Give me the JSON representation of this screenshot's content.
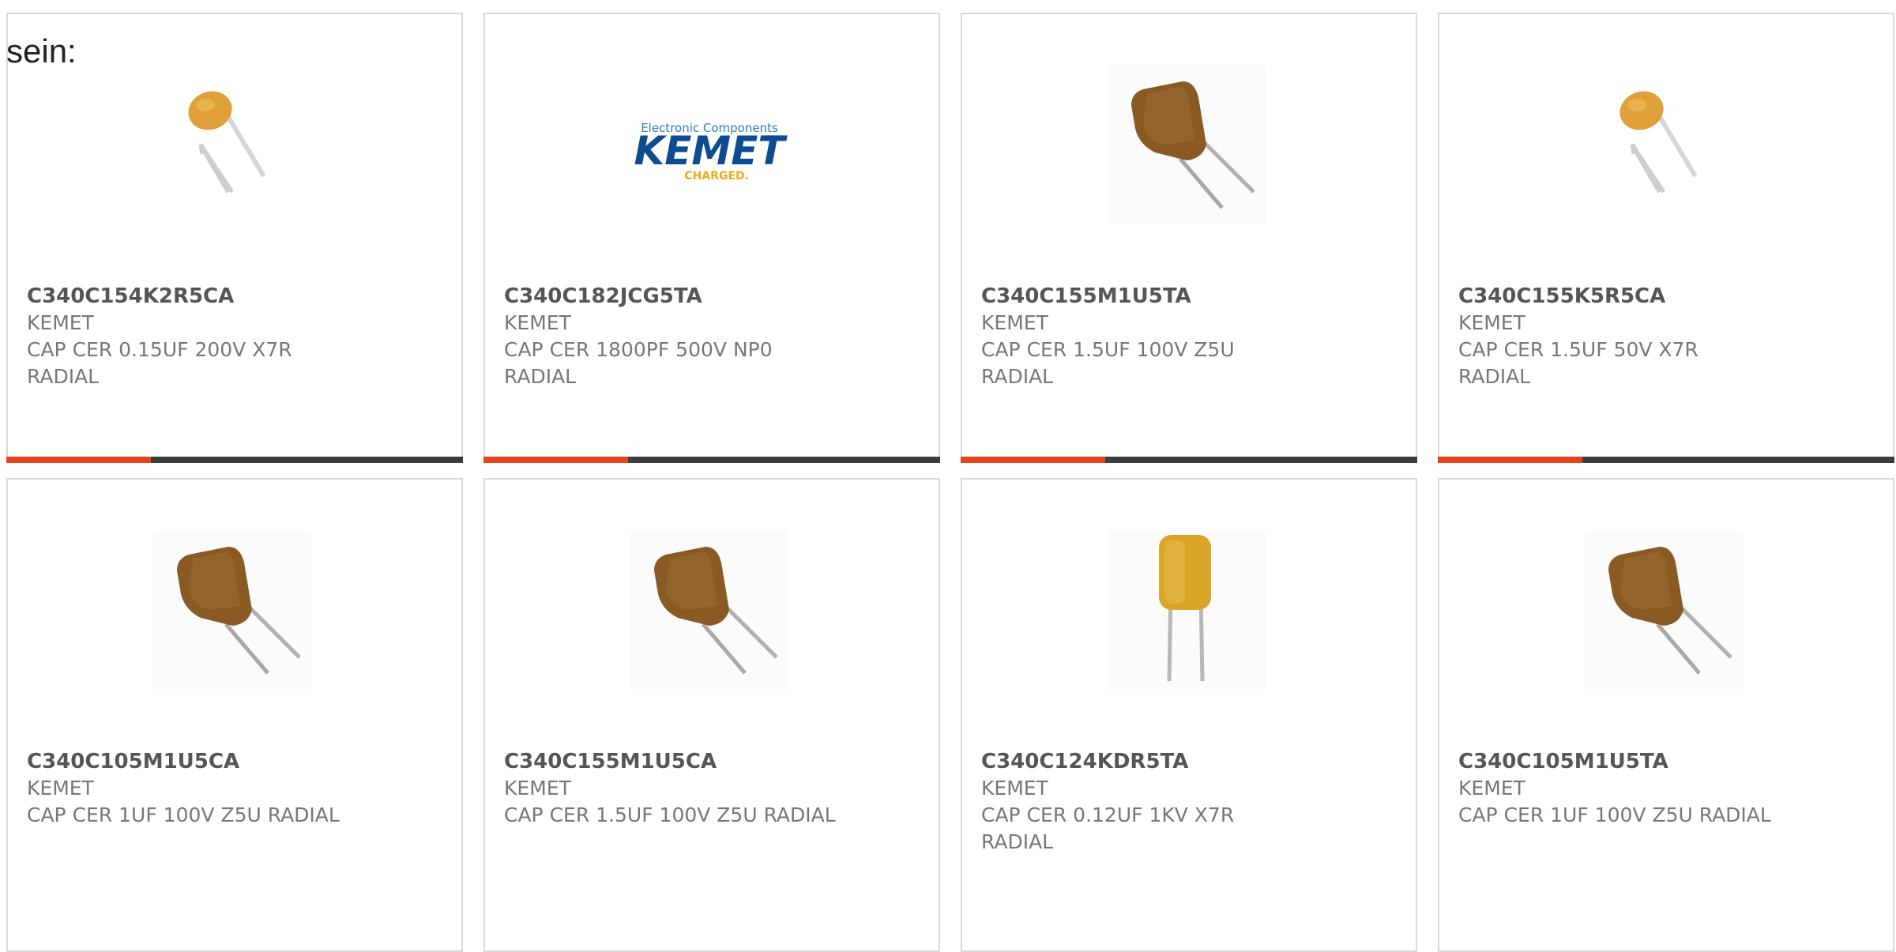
{
  "intro_text": "sein:",
  "products": [
    {
      "part": "C340C154K2R5CA",
      "mfr": "KEMET",
      "desc": "CAP CER 0.15UF 200V X7R RADIAL",
      "image": "small-orange-radial-capacitor-icon"
    },
    {
      "part": "C340C182JCG5TA",
      "mfr": "KEMET",
      "desc": "CAP CER 1800PF 500V NP0 RADIAL",
      "image": "kemet-logo",
      "logo": {
        "top": "Electronic Components",
        "main": "KEMET",
        "sub": "CHARGED."
      }
    },
    {
      "part": "C340C155M1U5TA",
      "mfr": "KEMET",
      "desc": "CAP CER 1.5UF 100V Z5U RADIAL",
      "image": "brown-radial-capacitor-icon"
    },
    {
      "part": "C340C155K5R5CA",
      "mfr": "KEMET",
      "desc": "CAP CER 1.5UF 50V X7R RADIAL",
      "image": "small-orange-radial-capacitor-icon"
    },
    {
      "part": "C340C105M1U5CA",
      "mfr": "KEMET",
      "desc": "CAP CER 1UF 100V Z5U RADIAL",
      "image": "brown-radial-capacitor-icon"
    },
    {
      "part": "C340C155M1U5CA",
      "mfr": "KEMET",
      "desc": "CAP CER 1.5UF 100V Z5U RADIAL",
      "image": "brown-radial-capacitor-icon"
    },
    {
      "part": "C340C124KDR5TA",
      "mfr": "KEMET",
      "desc": "CAP CER 0.12UF 1KV X7R RADIAL",
      "image": "yellow-upright-capacitor-icon"
    },
    {
      "part": "C340C105M1U5TA",
      "mfr": "KEMET",
      "desc": "CAP CER 1UF 100V Z5U RADIAL",
      "image": "brown-radial-capacitor-icon"
    }
  ],
  "colors": {
    "accent": "#e8431a",
    "bar": "#3d3d3d",
    "border": "#d9d9d9"
  }
}
